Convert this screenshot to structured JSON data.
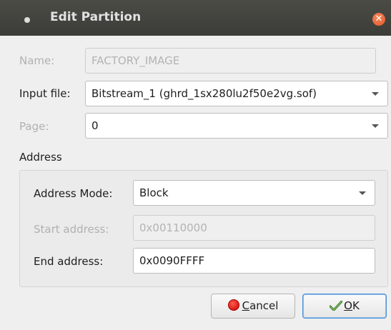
{
  "window": {
    "title": "Edit Partition",
    "close_glyph": "✕"
  },
  "form": {
    "name_label": "Name:",
    "name_value": "FACTORY_IMAGE",
    "input_file_label": "Input file:",
    "input_file_value": "Bitstream_1 (ghrd_1sx280lu2f50e2vg.sof)",
    "page_label": "Page:",
    "page_value": "0"
  },
  "address": {
    "section_label": "Address",
    "mode_label": "Address Mode:",
    "mode_value": "Block",
    "start_label": "Start address:",
    "start_value": "0x00110000",
    "end_label": "End address:",
    "end_value": "0x0090FFFF"
  },
  "buttons": {
    "cancel_mnemonic": "C",
    "cancel_rest": "ancel",
    "ok_mnemonic": "O",
    "ok_rest": "K"
  },
  "icons": {
    "cancel": "stop-icon",
    "ok": "checkmark-icon",
    "close": "close-icon",
    "window_menu": "window-menu-icon"
  },
  "colors": {
    "titlebar": "#3f3f3b",
    "close_button": "#e9602c",
    "default_button_border": "#4a90d9"
  }
}
